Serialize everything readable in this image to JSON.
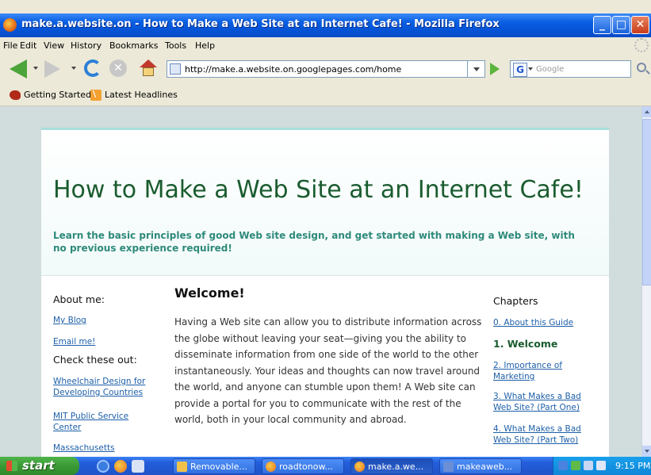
{
  "window": {
    "title": "make.a.website.on - How to Make a Web Site at an Internet Cafe! - Mozilla Firefox",
    "controls": [
      "minimize",
      "maximize",
      "close"
    ]
  },
  "menu": [
    "File",
    "Edit",
    "View",
    "History",
    "Bookmarks",
    "Tools",
    "Help"
  ],
  "navbar": {
    "url": "http://make.a.website.on.googlepages.com/home",
    "search_placeholder": "Google"
  },
  "bookmarks": [
    "Getting Started",
    "Latest Headlines"
  ],
  "page": {
    "title": "How to Make a Web Site at an Internet Cafe!",
    "subtitle": "Learn the basic principles of good Web site design, and get started with making a Web site, with no previous experience required!",
    "left": {
      "about_heading": "About me:",
      "about_links": [
        "My Blog",
        "Email me!"
      ],
      "check_heading": "Check these out:",
      "check_links": [
        "Wheelchair Design for Developing Countries",
        "MIT Public Service Center",
        "Massachusetts"
      ]
    },
    "main": {
      "heading": "Welcome!",
      "paragraph": "Having a Web site can allow you to distribute information across the globe without leaving your seat—giving you the ability to disseminate information from one side of the world to the other instantaneously. Your ideas and thoughts can now travel around the world, and anyone can stumble upon them! A Web site can provide a portal for you to communicate with the rest of the world, both in your local community and abroad."
    },
    "chapters": {
      "heading": "Chapters",
      "items": [
        "0. About this Guide",
        "1. Welcome",
        "2. Importance of Marketing",
        "3. What Makes a Bad Web Site? (Part One)",
        "4. What Makes a Bad Web Site? (Part Two)"
      ],
      "current": "1. Welcome"
    }
  },
  "taskbar": {
    "start": "start",
    "windows": [
      "Removable...",
      "roadtonow...",
      "make.a.we...",
      "makeaweb..."
    ],
    "active_window": "make.a.we...",
    "time": "9:15 PM"
  }
}
